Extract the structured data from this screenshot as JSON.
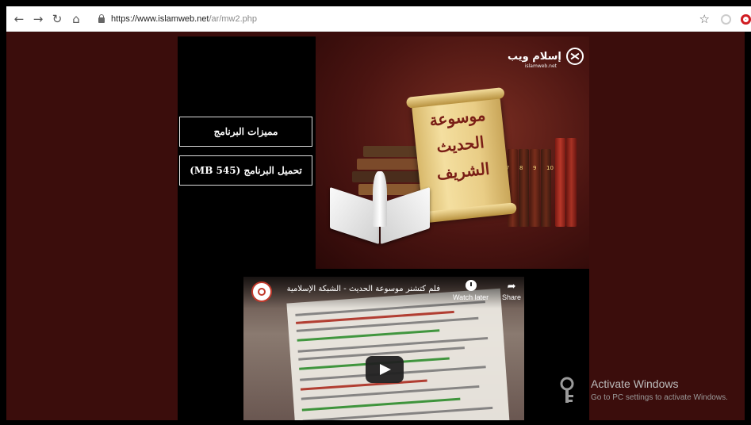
{
  "browser": {
    "url_host": "https://www.islamweb.net",
    "url_path": "/ar/mw2.php",
    "nav_icons": [
      "back-arrow-icon",
      "forward-arrow-icon",
      "reload-icon",
      "home-icon"
    ],
    "right_icons": [
      "bookmark-star-icon",
      "extension-icon",
      "opera-icon"
    ]
  },
  "site": {
    "logo_ar": "إسلام ويب",
    "logo_en": "islamweb.net"
  },
  "menu": {
    "features": "مميزات البرنامج",
    "download": "تحميل البرنامج (545 MB)"
  },
  "hero": {
    "scroll_lines": [
      "موسوعة",
      "الحديث",
      "الشريف"
    ],
    "book_numbers": [
      "7",
      "8",
      "9",
      "10"
    ]
  },
  "video": {
    "title": "فلم كتشنر موسوعة الحديث - الشبكة الإسلامية",
    "watch_later": "Watch later",
    "share": "Share"
  },
  "activation": {
    "title": "Activate Windows",
    "subtitle": "Go to PC settings to activate Windows."
  },
  "colors": {
    "page_background": "#3b0d0c",
    "panel_background": "#000000",
    "scroll_text": "#7a1e16"
  }
}
